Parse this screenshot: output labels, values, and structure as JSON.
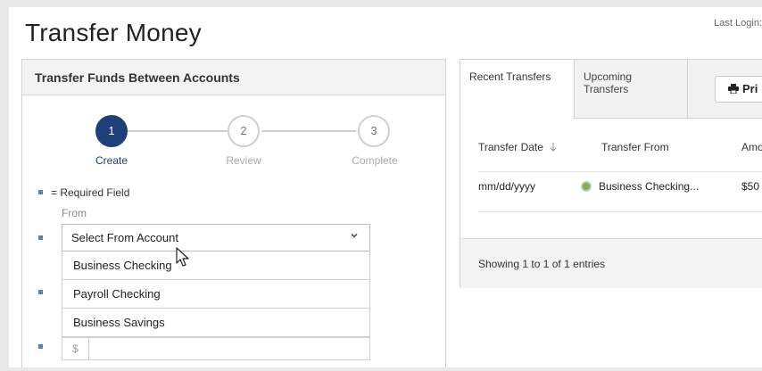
{
  "header": {
    "title": "Transfer Money",
    "last_login": "Last Login:"
  },
  "transfer_panel": {
    "title": "Transfer Funds Between Accounts",
    "steps": [
      {
        "number": "1",
        "label": "Create",
        "state": "active"
      },
      {
        "number": "2",
        "label": "Review",
        "state": "inactive"
      },
      {
        "number": "3",
        "label": "Complete",
        "state": "inactive"
      }
    ],
    "required_note": "= Required Field",
    "from_label": "From",
    "from_select": {
      "value": "Select From Account",
      "options": [
        "Business Checking",
        "Payroll Checking",
        "Business Savings"
      ]
    },
    "amount_prefix": "$"
  },
  "recent_panel": {
    "tabs": [
      {
        "label": "Recent Transfers",
        "active": true
      },
      {
        "label": "Upcoming Transfers",
        "active": false
      }
    ],
    "print_label": "Pri",
    "columns": [
      "Transfer Date",
      "Transfer From",
      "Amo"
    ],
    "rows": [
      {
        "date": "mm/dd/yyyy",
        "from": "Business Checking...",
        "amount": "$50"
      }
    ],
    "footer": "Showing 1 to 1 of 1 entries"
  },
  "colors": {
    "accent": "#1f3f7a",
    "required_bullet": "#4a86c5",
    "status_ok": "#7cb342"
  },
  "icons": [
    "chevron-down-icon",
    "printer-icon",
    "sort-arrow-icon",
    "status-check-icon",
    "mouse-cursor-icon"
  ]
}
